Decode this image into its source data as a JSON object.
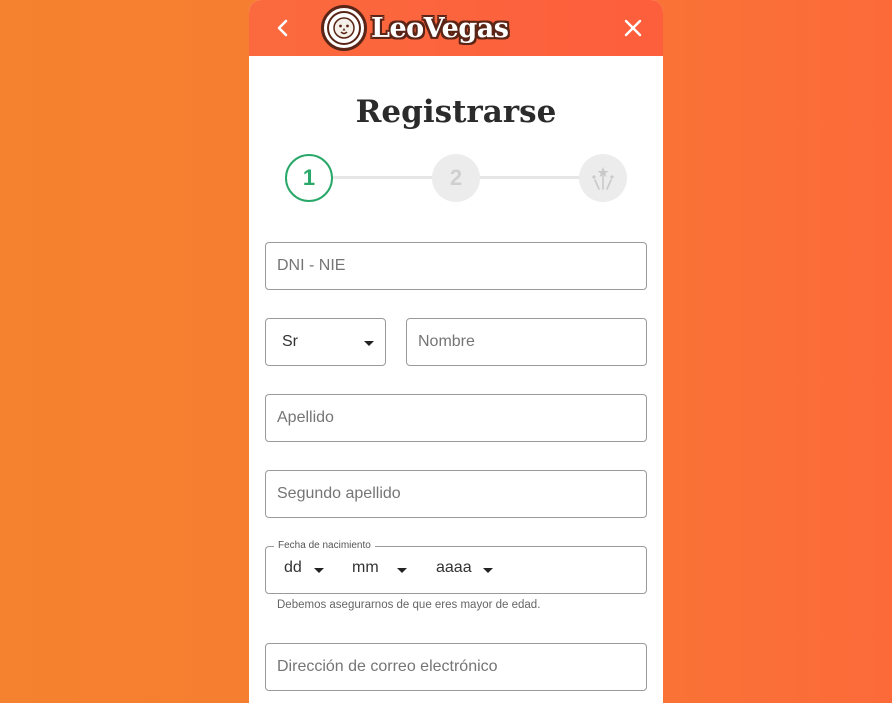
{
  "header": {
    "brand": "LeoVegas",
    "back_icon": "chevron-left-icon",
    "close_icon": "close-icon",
    "logo_icon": "lion-logo-icon"
  },
  "title": "Registrarse",
  "stepper": {
    "steps": [
      {
        "label": "1",
        "state": "active"
      },
      {
        "label": "2",
        "state": "inactive"
      },
      {
        "label": "",
        "icon": "fireworks-icon",
        "state": "inactive"
      }
    ]
  },
  "form": {
    "dni": {
      "placeholder": "DNI - NIE"
    },
    "title_select": {
      "value": "Sr"
    },
    "nombre": {
      "placeholder": "Nombre"
    },
    "apellido": {
      "placeholder": "Apellido"
    },
    "segundo_apellido": {
      "placeholder": "Segundo apellido"
    },
    "dob": {
      "legend": "Fecha de nacimiento",
      "day": "dd",
      "month": "mm",
      "year": "aaaa",
      "helper": "Debemos asegurarnos de que eres mayor de edad."
    },
    "email": {
      "placeholder": "Dirección de correo electrónico"
    }
  },
  "colors": {
    "background": "#f7802f",
    "header": "#fc643d",
    "active_step": "#2aa86a",
    "inactive_step": "#ececec",
    "logo_outline": "#5a2416"
  }
}
